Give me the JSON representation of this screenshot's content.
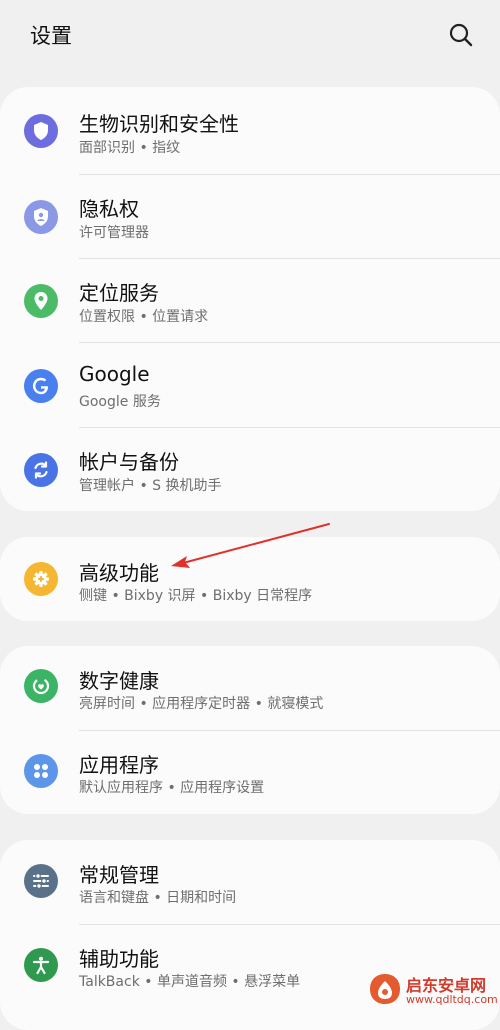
{
  "header": {
    "title": "设置",
    "search_icon": "search-icon"
  },
  "groups": [
    {
      "items": [
        {
          "title": "生物识别和安全性",
          "subtitle": "面部识别 • 指纹",
          "icon": "shield-icon",
          "color": "#6d6de0"
        },
        {
          "title": "隐私权",
          "subtitle": "许可管理器",
          "icon": "privacy-shield-icon",
          "color": "#8a98e6"
        },
        {
          "title": "定位服务",
          "subtitle": "位置权限 • 位置请求",
          "icon": "location-pin-icon",
          "color": "#4cbb67"
        },
        {
          "title": "Google",
          "subtitle": "Google 服务",
          "icon": "google-icon",
          "color": "#4a7ff0"
        },
        {
          "title": "帐户与备份",
          "subtitle": "管理帐户 • S 换机助手",
          "icon": "sync-icon",
          "color": "#4a74e6"
        }
      ]
    },
    {
      "items": [
        {
          "title": "高级功能",
          "subtitle": "侧键 • Bixby 识屏 • Bixby 日常程序",
          "icon": "gear-plus-icon",
          "color": "#f5b731"
        }
      ]
    },
    {
      "items": [
        {
          "title": "数字健康",
          "subtitle": "亮屏时间 • 应用程序定时器 • 就寝模式",
          "icon": "digital-wellbeing-icon",
          "color": "#3cb466"
        },
        {
          "title": "应用程序",
          "subtitle": "默认应用程序 • 应用程序设置",
          "icon": "apps-grid-icon",
          "color": "#5b96e8"
        }
      ]
    },
    {
      "items": [
        {
          "title": "常规管理",
          "subtitle": "语言和键盘 • 日期和时间",
          "icon": "sliders-icon",
          "color": "#5a7289"
        },
        {
          "title": "辅助功能",
          "subtitle": "TalkBack • 单声道音频 • 悬浮菜单",
          "icon": "accessibility-icon",
          "color": "#2f9a4f"
        }
      ]
    }
  ],
  "annotation": {
    "arrow_color": "#e0322a"
  },
  "watermark": {
    "name": "启东安卓网",
    "url": "www.qdltdq.com"
  }
}
